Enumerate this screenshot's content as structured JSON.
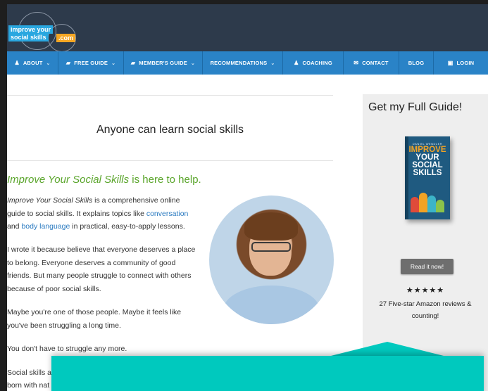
{
  "logo": {
    "line1": "improve your",
    "line2": "social skills",
    "dot": ".com"
  },
  "nav": [
    {
      "label": "ABOUT",
      "icon": "person-icon",
      "glyph": "♟",
      "dropdown": true
    },
    {
      "label": "FREE GUIDE",
      "icon": "book-icon",
      "glyph": "▰",
      "dropdown": true
    },
    {
      "label": "MEMBER'S GUIDE",
      "icon": "book-icon",
      "glyph": "▰",
      "dropdown": true
    },
    {
      "label": "RECOMMENDATIONS",
      "icon": "",
      "glyph": "",
      "dropdown": true
    },
    {
      "label": "COACHING",
      "icon": "person-icon",
      "glyph": "♟",
      "dropdown": false
    },
    {
      "label": "CONTACT",
      "icon": "envelope-icon",
      "glyph": "✉",
      "dropdown": false
    },
    {
      "label": "BLOG",
      "icon": "",
      "glyph": "",
      "dropdown": false
    },
    {
      "label": "LOGIN",
      "icon": "lock-icon",
      "glyph": "▣",
      "dropdown": false
    }
  ],
  "main": {
    "tagline": "Anyone can learn social skills",
    "intro_brand": "Improve Your Social Skills",
    "intro_rest": " is here to help.",
    "p1": {
      "brand": "Improve Your Social Skills",
      "t1": " is a comprehensive online guide to social skills. It explains topics like ",
      "link1": "conversation",
      "t2": " and ",
      "link2": "body language",
      "t3": " in practical, easy-to-apply lessons."
    },
    "p2": "I wrote it because believe that everyone deserves a place to belong. Everyone deserves a community of good friends. But many people struggle to connect with others because of poor social skills.",
    "p3": "Maybe you're one of those people. Maybe it feels like you've been struggling a long time.",
    "p4": "You don't have to struggle any more.",
    "p5": "Social skills a",
    "p6": "born with nat"
  },
  "sidebar": {
    "title": "Get my Full Guide!",
    "book_author": "DANIEL WENDLER",
    "book_title": [
      "IMPROVE",
      "YOUR",
      "SOCIAL",
      "SKILLS"
    ],
    "button": "Read it now!",
    "stars": "★★★★★",
    "reviews": "27 Five-star Amazon reviews & counting!"
  },
  "colors": {
    "header_bg": "#2d3a4b",
    "nav_bg": "#2a83c7",
    "accent_green": "#5aa52b",
    "link_blue": "#2a7ac0",
    "overlay_teal": "#00c9be"
  }
}
